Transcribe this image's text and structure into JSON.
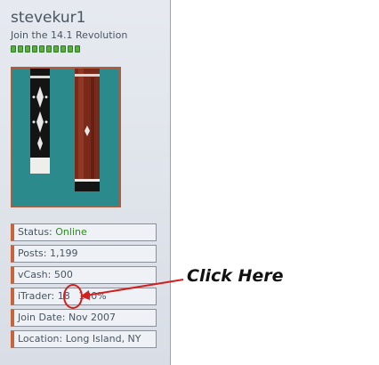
{
  "profile": {
    "username": "stevekur1",
    "subtitle": "Join the 14.1 Revolution",
    "reputation_pips": 10,
    "colors": {
      "accent": "#c8643c",
      "online": "#2e8b20",
      "rep": "#55b040",
      "annotation": "#d22020"
    }
  },
  "fields": {
    "status_label": "Status:",
    "status_value": "Online",
    "posts": "Posts: 1,199",
    "vcash": "vCash: 500",
    "itrader_label": "iTrader:",
    "itrader_count": "18",
    "itrader_percent": "100%",
    "join_date": "Join Date: Nov 2007",
    "location": "Location: Long Island, NY"
  },
  "annotation": {
    "callout_text": "Click Here"
  }
}
